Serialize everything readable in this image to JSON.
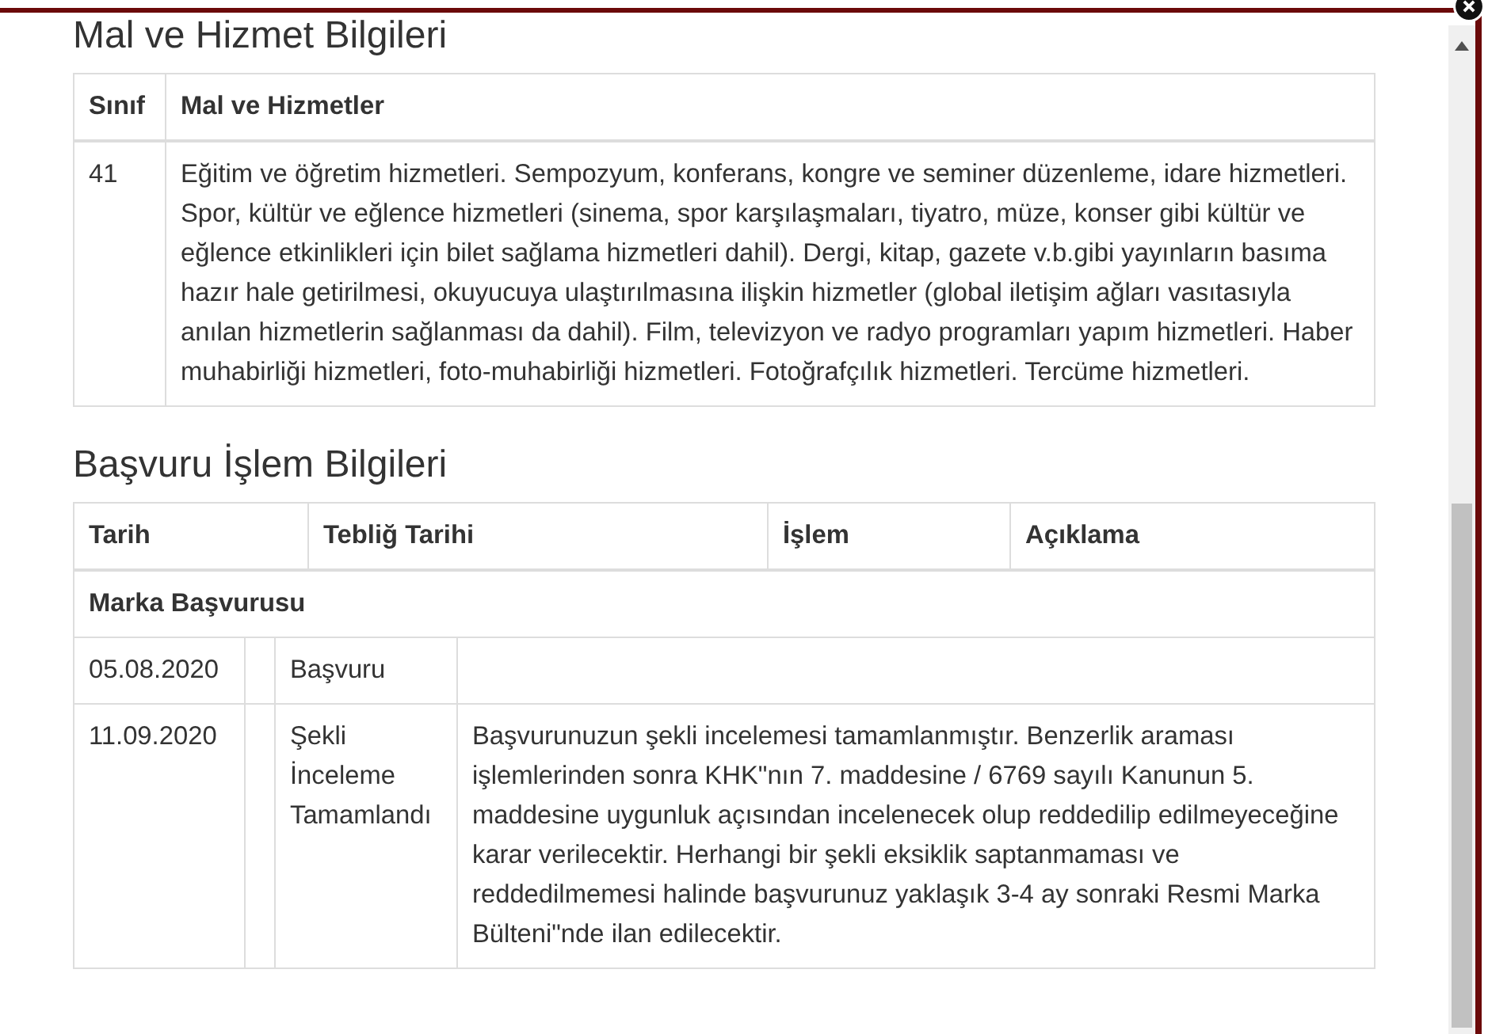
{
  "goods_section": {
    "title": "Mal ve Hizmet Bilgileri",
    "columns": [
      "Sınıf",
      "Mal ve Hizmetler"
    ],
    "rows": [
      {
        "class": "41",
        "description": "Eğitim ve öğretim hizmetleri. Sempozyum, konferans, kongre ve seminer düzenleme, idare hizmetleri. Spor, kültür ve eğlence hizmetleri (sinema, spor karşılaşmaları, tiyatro, müze, konser gibi kültür ve eğlence etkinlikleri için bilet sağlama hizmetleri dahil). Dergi, kitap, gazete v.b.gibi yayınların basıma hazır hale getirilmesi, okuyucuya ulaştırılmasına ilişkin hizmetler (global iletişim ağları vasıtasıyla anılan hizmetlerin sağlanması da dahil). Film, televizyon ve radyo programları yapım hizmetleri. Haber muhabirliği hizmetleri, foto-muhabirliği hizmetleri. Fotoğrafçılık hizmetleri. Tercüme hizmetleri."
      }
    ]
  },
  "process_section": {
    "title": "Başvuru İşlem Bilgileri",
    "columns": [
      "Tarih",
      "Tebliğ Tarihi",
      "İşlem",
      "Açıklama"
    ],
    "groups": [
      {
        "title": "Marka Başvurusu",
        "rows": [
          {
            "date": "05.08.2020",
            "action": "Başvuru"
          },
          {
            "date": "11.09.2020",
            "action": "Şekli İnceleme Tamamlandı",
            "note": "Başvurunuzun şekli incelemesi tamamlanmıştır. Benzerlik araması işlemlerinden sonra KHK\"nın 7. maddesine / 6769 sayılı Kanunun 5. maddesine uygunluk açısından incelenecek olup reddedilip edilmeyeceğine karar verilecektir. Herhangi bir şekli eksiklik saptanmaması ve reddedilmemesi halinde başvurunuz yaklaşık 3-4 ay sonraki Resmi Marka Bülteni\"nde ilan edilecektir."
          }
        ]
      }
    ]
  }
}
